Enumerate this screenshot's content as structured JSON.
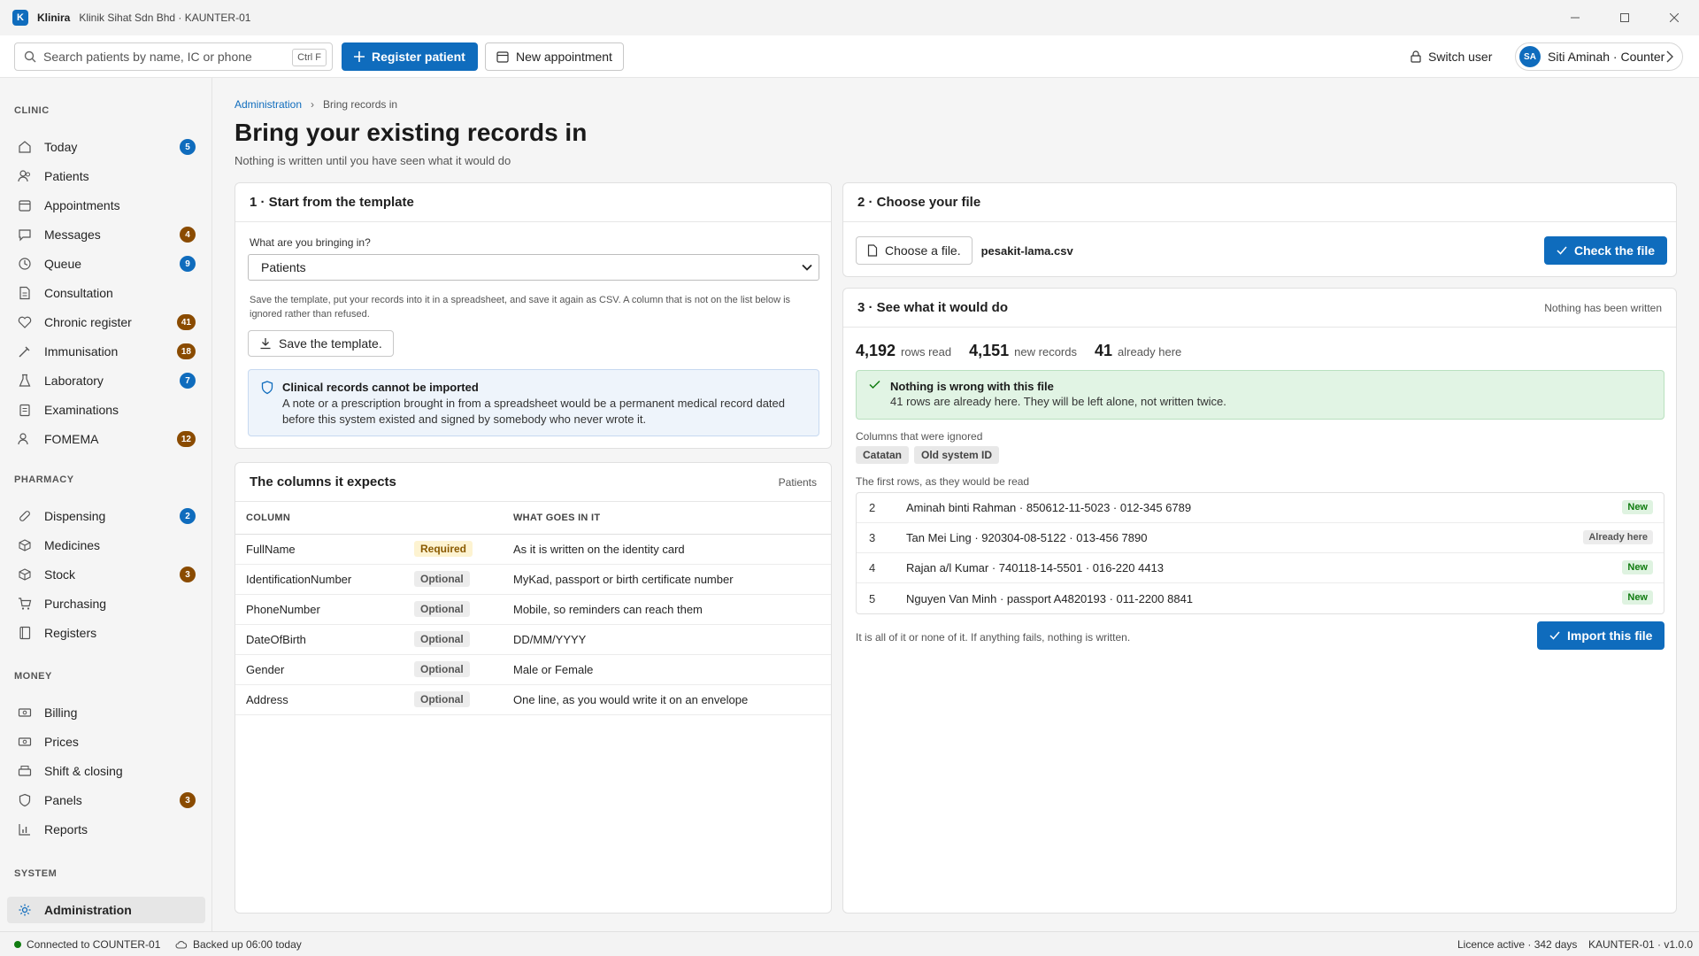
{
  "window": {
    "app_name": "Klinira",
    "subtitle": "Klinik Sihat Sdn Bhd · KAUNTER-01",
    "logo_letter": "K"
  },
  "toolbar": {
    "search_placeholder": "Search patients by name, IC or phone",
    "search_shortcut": "Ctrl F",
    "register_label": "Register patient",
    "appointment_label": "New appointment",
    "switch_user_label": "Switch user",
    "user_initials": "SA",
    "user_label": "Siti Aminah · Counter"
  },
  "sidebar": {
    "sections": [
      {
        "title": "CLINIC",
        "items": [
          {
            "label": "Today",
            "icon": "home-icon",
            "badge": "5",
            "badge_color": "blue"
          },
          {
            "label": "Patients",
            "icon": "people-icon"
          },
          {
            "label": "Appointments",
            "icon": "calendar-icon"
          },
          {
            "label": "Messages",
            "icon": "chat-icon",
            "badge": "4",
            "badge_color": "brown"
          },
          {
            "label": "Queue",
            "icon": "clock-icon",
            "badge": "9",
            "badge_color": "blue"
          },
          {
            "label": "Consultation",
            "icon": "document-icon"
          },
          {
            "label": "Chronic register",
            "icon": "heart-icon",
            "badge": "41",
            "badge_color": "brown"
          },
          {
            "label": "Immunisation",
            "icon": "syringe-icon",
            "badge": "18",
            "badge_color": "brown"
          },
          {
            "label": "Laboratory",
            "icon": "flask-icon",
            "badge": "7",
            "badge_color": "blue"
          },
          {
            "label": "Examinations",
            "icon": "clipboard-icon"
          },
          {
            "label": "FOMEMA",
            "icon": "people-icon",
            "badge": "12",
            "badge_color": "brown"
          }
        ]
      },
      {
        "title": "PHARMACY",
        "items": [
          {
            "label": "Dispensing",
            "icon": "pill-icon",
            "badge": "2",
            "badge_color": "blue"
          },
          {
            "label": "Medicines",
            "icon": "box-icon"
          },
          {
            "label": "Stock",
            "icon": "box-icon",
            "badge": "3",
            "badge_color": "brown"
          },
          {
            "label": "Purchasing",
            "icon": "cart-icon"
          },
          {
            "label": "Registers",
            "icon": "book-icon"
          }
        ]
      },
      {
        "title": "MONEY",
        "items": [
          {
            "label": "Billing",
            "icon": "money-icon"
          },
          {
            "label": "Prices",
            "icon": "money-icon"
          },
          {
            "label": "Shift & closing",
            "icon": "cash-drawer-icon"
          },
          {
            "label": "Panels",
            "icon": "shield-icon",
            "badge": "3",
            "badge_color": "brown"
          },
          {
            "label": "Reports",
            "icon": "chart-icon"
          }
        ]
      },
      {
        "title": "SYSTEM",
        "items": [
          {
            "label": "Administration",
            "icon": "gear-icon",
            "active": true
          }
        ]
      }
    ]
  },
  "breadcrumb": {
    "parent": "Administration",
    "current": "Bring records in"
  },
  "page": {
    "title": "Bring your existing records in",
    "subtitle": "Nothing is written until you have seen what it would do"
  },
  "template_card": {
    "title": "1 · Start from the template",
    "field_label": "What are you bringing in?",
    "selected": "Patients",
    "hint": "Save the template, put your records into it in a spreadsheet, and save it again as CSV. A column that is not on the list below is ignored rather than refused.",
    "save_label": "Save the template.",
    "notice_title": "Clinical records cannot be imported",
    "notice_text": "A note or a prescription brought in from a spreadsheet would be a permanent medical record dated before this system existed and signed by somebody who never wrote it."
  },
  "columns_card": {
    "title": "The columns it expects",
    "aside": "Patients",
    "headers": [
      "COLUMN",
      "",
      "WHAT GOES IN IT"
    ],
    "rows": [
      {
        "name": "FullName",
        "status": "Required",
        "what": "As it is written on the identity card"
      },
      {
        "name": "IdentificationNumber",
        "status": "Optional",
        "what": "MyKad, passport or birth certificate number"
      },
      {
        "name": "PhoneNumber",
        "status": "Optional",
        "what": "Mobile, so reminders can reach them"
      },
      {
        "name": "DateOfBirth",
        "status": "Optional",
        "what": "DD/MM/YYYY"
      },
      {
        "name": "Gender",
        "status": "Optional",
        "what": "Male or Female"
      },
      {
        "name": "Address",
        "status": "Optional",
        "what": "One line, as you would write it on an envelope"
      }
    ]
  },
  "file_card": {
    "title": "2 · Choose your file",
    "choose_label": "Choose a file.",
    "file_name": "pesakit-lama.csv",
    "check_label": "Check the file"
  },
  "preview_card": {
    "title": "3 · See what it would do",
    "aside": "Nothing has been written",
    "stats": [
      {
        "num": "4,192",
        "label": "rows read"
      },
      {
        "num": "4,151",
        "label": "new records"
      },
      {
        "num": "41",
        "label": "already here"
      }
    ],
    "ok_title": "Nothing is wrong with this file",
    "ok_text": "41 rows are already here. They will be left alone, not written twice.",
    "ignored_label": "Columns that were ignored",
    "ignored": [
      "Catatan",
      "Old system ID"
    ],
    "rows_label": "The first rows, as they would be read",
    "rows": [
      {
        "num": "2",
        "text": "Aminah binti Rahman · 850612-11-5023 · 012-345 6789",
        "status": "New"
      },
      {
        "num": "3",
        "text": "Tan Mei Ling · 920304-08-5122 · 013-456 7890",
        "status": "Already here"
      },
      {
        "num": "4",
        "text": "Rajan a/l Kumar · 740118-14-5501 · 016-220 4413",
        "status": "New"
      },
      {
        "num": "5",
        "text": "Nguyen Van Minh · passport A4820193 · 011-2200 8841",
        "status": "New"
      }
    ],
    "foot_note": "It is all of it or none of it. If anything fails, nothing is written.",
    "import_label": "Import this file"
  },
  "statusbar": {
    "connection": "Connected to COUNTER-01",
    "backup": "Backed up 06:00 today",
    "licence": "Licence active · 342 days",
    "version": "KAUNTER-01 · v1.0.0"
  },
  "colors": {
    "accent": "#0f6cbd",
    "badge_brown": "#8a4b00",
    "success": "#107c10"
  }
}
